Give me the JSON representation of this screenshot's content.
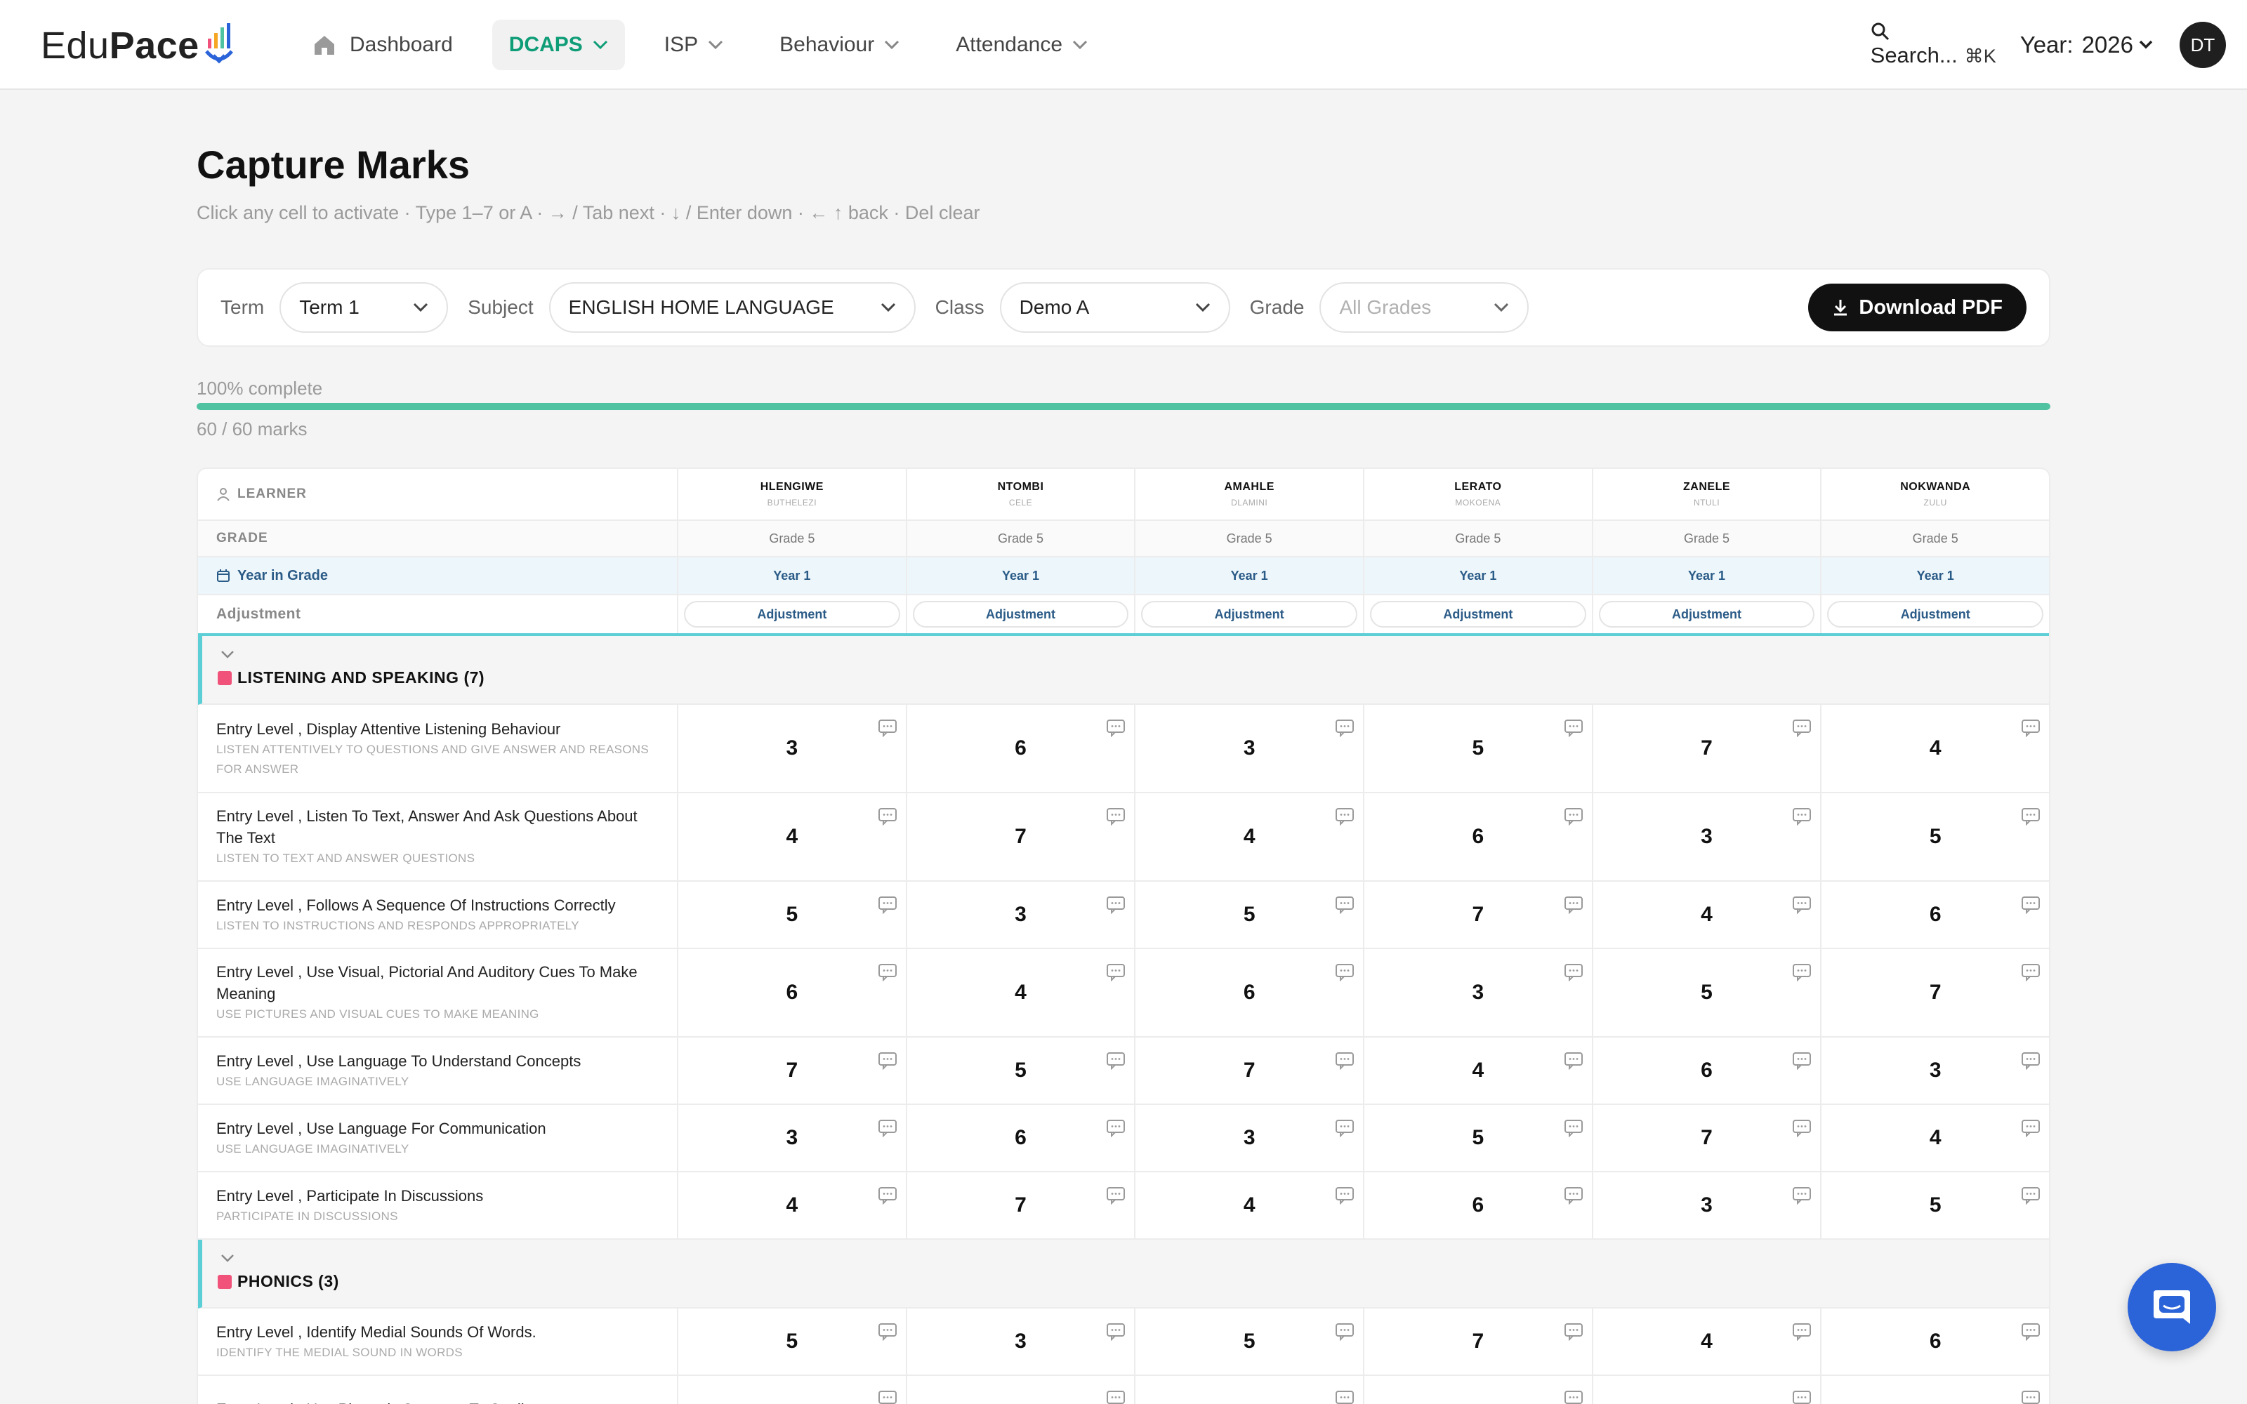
{
  "brand": {
    "name_light": "Edu",
    "name_bold": "Pace"
  },
  "nav": {
    "items": [
      {
        "label": "Dashboard",
        "icon": "home-icon"
      },
      {
        "label": "DCAPS"
      },
      {
        "label": "ISP"
      },
      {
        "label": "Behaviour"
      },
      {
        "label": "Attendance"
      }
    ],
    "search_label": "Search...",
    "search_shortcut": "⌘K",
    "year_label": "Year:",
    "year_value": "2026",
    "avatar_initials": "DT"
  },
  "page": {
    "title": "Capture Marks",
    "hint": "Click any cell to activate · Type 1–7 or A · → / Tab next · ↓ / Enter down · ← ↑ back · Del clear"
  },
  "filters": {
    "term_label": "Term",
    "term_value": "Term 1",
    "subject_label": "Subject",
    "subject_value": "ENGLISH HOME LANGUAGE",
    "class_label": "Class",
    "class_value": "Demo A",
    "grade_label": "Grade",
    "grade_placeholder": "All Grades",
    "download_label": "Download PDF"
  },
  "progress": {
    "label": "100% complete",
    "fraction": 1.0,
    "count": "60 / 60 marks",
    "color": "#4fc3a1"
  },
  "table": {
    "learner_header": "LEARNER",
    "grade_header": "GRADE",
    "year_header": "Year in Grade",
    "adjustment_header": "Adjustment",
    "students": [
      {
        "first": "HLENGIWE",
        "last": "BUTHELEZI",
        "grade": "Grade 5",
        "year": "Year 1",
        "adjustment": "Adjustment"
      },
      {
        "first": "NTOMBI",
        "last": "CELE",
        "grade": "Grade 5",
        "year": "Year 1",
        "adjustment": "Adjustment"
      },
      {
        "first": "AMAHLE",
        "last": "DLAMINI",
        "grade": "Grade 5",
        "year": "Year 1",
        "adjustment": "Adjustment"
      },
      {
        "first": "LERATO",
        "last": "MOKOENA",
        "grade": "Grade 5",
        "year": "Year 1",
        "adjustment": "Adjustment"
      },
      {
        "first": "ZANELE",
        "last": "NTULI",
        "grade": "Grade 5",
        "year": "Year 1",
        "adjustment": "Adjustment"
      },
      {
        "first": "NOKWANDA",
        "last": "ZULU",
        "grade": "Grade 5",
        "year": "Year 1",
        "adjustment": "Adjustment"
      }
    ],
    "sections": [
      {
        "title": "LISTENING AND SPEAKING (7)",
        "color": "#f0527a",
        "criteria": [
          {
            "title": "Entry Level , Display Attentive Listening Behaviour",
            "sub": "LISTEN ATTENTIVELY TO QUESTIONS AND GIVE ANSWER AND REASONS FOR ANSWER",
            "marks": [
              "3",
              "6",
              "3",
              "5",
              "7",
              "4"
            ]
          },
          {
            "title": "Entry Level , Listen To Text, Answer And Ask Questions About The Text",
            "sub": "LISTEN TO TEXT AND ANSWER QUESTIONS",
            "marks": [
              "4",
              "7",
              "4",
              "6",
              "3",
              "5"
            ]
          },
          {
            "title": "Entry Level , Follows A Sequence Of Instructions Correctly",
            "sub": "LISTEN TO INSTRUCTIONS AND RESPONDS APPROPRIATELY",
            "marks": [
              "5",
              "3",
              "5",
              "7",
              "4",
              "6"
            ]
          },
          {
            "title": "Entry Level , Use Visual, Pictorial And Auditory Cues To Make Meaning",
            "sub": "USE PICTURES AND VISUAL CUES TO MAKE MEANING",
            "marks": [
              "6",
              "4",
              "6",
              "3",
              "5",
              "7"
            ]
          },
          {
            "title": "Entry Level , Use Language To Understand Concepts",
            "sub": "USE LANGUAGE IMAGINATIVELY",
            "marks": [
              "7",
              "5",
              "7",
              "4",
              "6",
              "3"
            ]
          },
          {
            "title": "Entry Level , Use Language For Communication",
            "sub": "USE LANGUAGE IMAGINATIVELY",
            "marks": [
              "3",
              "6",
              "3",
              "5",
              "7",
              "4"
            ]
          },
          {
            "title": "Entry Level , Participate In Discussions",
            "sub": "PARTICIPATE IN DISCUSSIONS",
            "marks": [
              "4",
              "7",
              "4",
              "6",
              "3",
              "5"
            ]
          }
        ]
      },
      {
        "title": "PHONICS (3)",
        "color": "#f0527a",
        "criteria": [
          {
            "title": "Entry Level , Identify Medial Sounds Of Words.",
            "sub": "IDENTIFY THE MEDIAL SOUND IN WORDS",
            "marks": [
              "5",
              "3",
              "5",
              "7",
              "4",
              "6"
            ]
          },
          {
            "title": "Entry Level , Use Phonetic Structure To Spell",
            "sub": "",
            "marks": [
              "",
              "",
              "",
              "",
              "",
              ""
            ]
          }
        ]
      }
    ]
  }
}
